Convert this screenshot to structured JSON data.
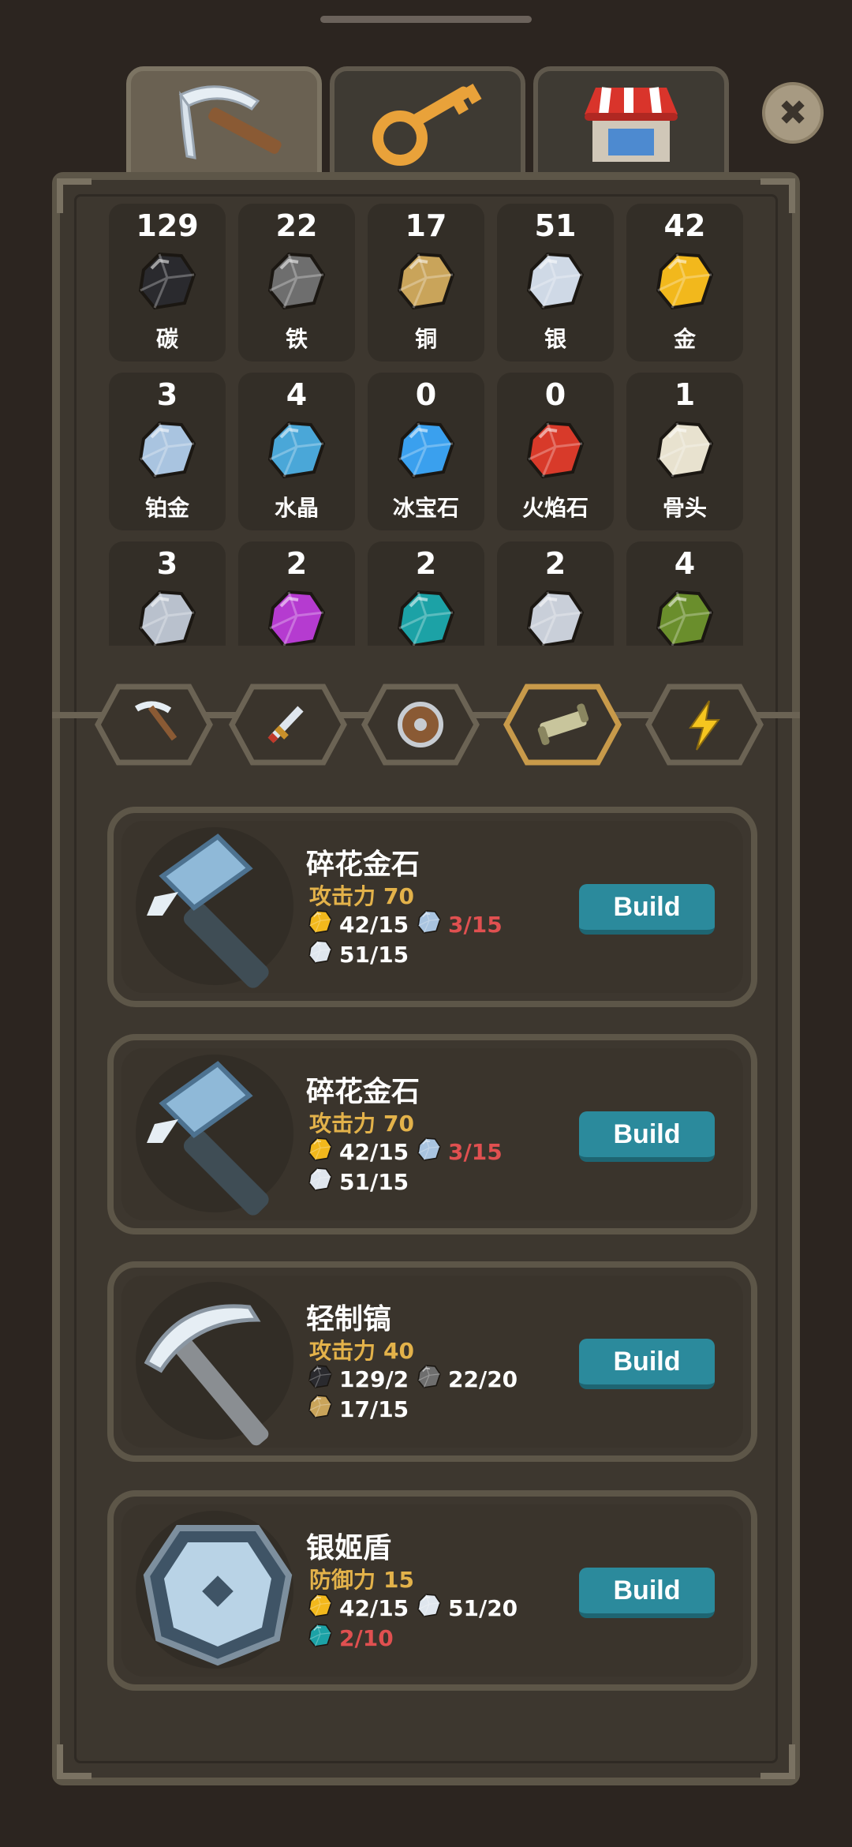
{
  "tabs": [
    {
      "name": "pickaxe-tab",
      "active": true
    },
    {
      "name": "key-tab",
      "active": false
    },
    {
      "name": "shop-tab",
      "active": false
    }
  ],
  "close_label": "✖",
  "resources": [
    {
      "count": "129",
      "name": "碳",
      "color": "#2a2a2e"
    },
    {
      "count": "22",
      "name": "铁",
      "color": "#6e6e6e"
    },
    {
      "count": "17",
      "name": "铜",
      "color": "#c9a45a"
    },
    {
      "count": "51",
      "name": "银",
      "color": "#cfd9e6"
    },
    {
      "count": "42",
      "name": "金",
      "color": "#f2b81c"
    },
    {
      "count": "3",
      "name": "铂金",
      "color": "#a9c4e0"
    },
    {
      "count": "4",
      "name": "水晶",
      "color": "#4aa7d8"
    },
    {
      "count": "0",
      "name": "冰宝石",
      "color": "#3aa0ee"
    },
    {
      "count": "0",
      "name": "火焰石",
      "color": "#d83a2a"
    },
    {
      "count": "1",
      "name": "骨头",
      "color": "#e8e2cf"
    },
    {
      "count": "3",
      "name": "",
      "color": "#b9c1cd"
    },
    {
      "count": "2",
      "name": "",
      "color": "#b53bd0"
    },
    {
      "count": "2",
      "name": "",
      "color": "#1ca2a6"
    },
    {
      "count": "2",
      "name": "",
      "color": "#c9cfd9"
    },
    {
      "count": "4",
      "name": "",
      "color": "#6a8e2c"
    }
  ],
  "categories": [
    {
      "name": "pickaxe"
    },
    {
      "name": "sword"
    },
    {
      "name": "shield"
    },
    {
      "name": "scroll",
      "active": true
    },
    {
      "name": "lightning"
    }
  ],
  "recipes": [
    {
      "title": "碎花金石",
      "stat_label": "攻击力",
      "stat_value": "70",
      "reqs": [
        {
          "icon": "gold",
          "text": "42/15",
          "lack": false
        },
        {
          "icon": "platinum",
          "text": "3/15",
          "lack": true
        },
        {
          "icon": "silver",
          "text": "51/15",
          "lack": false
        }
      ],
      "build": "Build",
      "art": "hammer"
    },
    {
      "title": "碎花金石",
      "stat_label": "攻击力",
      "stat_value": "70",
      "reqs": [
        {
          "icon": "gold",
          "text": "42/15",
          "lack": false
        },
        {
          "icon": "platinum",
          "text": "3/15",
          "lack": true
        },
        {
          "icon": "silver",
          "text": "51/15",
          "lack": false
        }
      ],
      "build": "Build",
      "art": "hammer"
    },
    {
      "title": "轻制镐",
      "stat_label": "攻击力",
      "stat_value": "40",
      "reqs": [
        {
          "icon": "carbon",
          "text": "129/2",
          "lack": false
        },
        {
          "icon": "iron",
          "text": "22/20",
          "lack": false
        },
        {
          "icon": "copper",
          "text": "17/15",
          "lack": false
        }
      ],
      "build": "Build",
      "art": "pickaxe"
    },
    {
      "title": "银姬盾",
      "stat_label": "防御力",
      "stat_value": "15",
      "reqs": [
        {
          "icon": "gold",
          "text": "42/15",
          "lack": false
        },
        {
          "icon": "silver",
          "text": "51/20",
          "lack": false
        },
        {
          "icon": "teal",
          "text": "2/10",
          "lack": true
        }
      ],
      "build": "Build",
      "art": "shield"
    }
  ]
}
